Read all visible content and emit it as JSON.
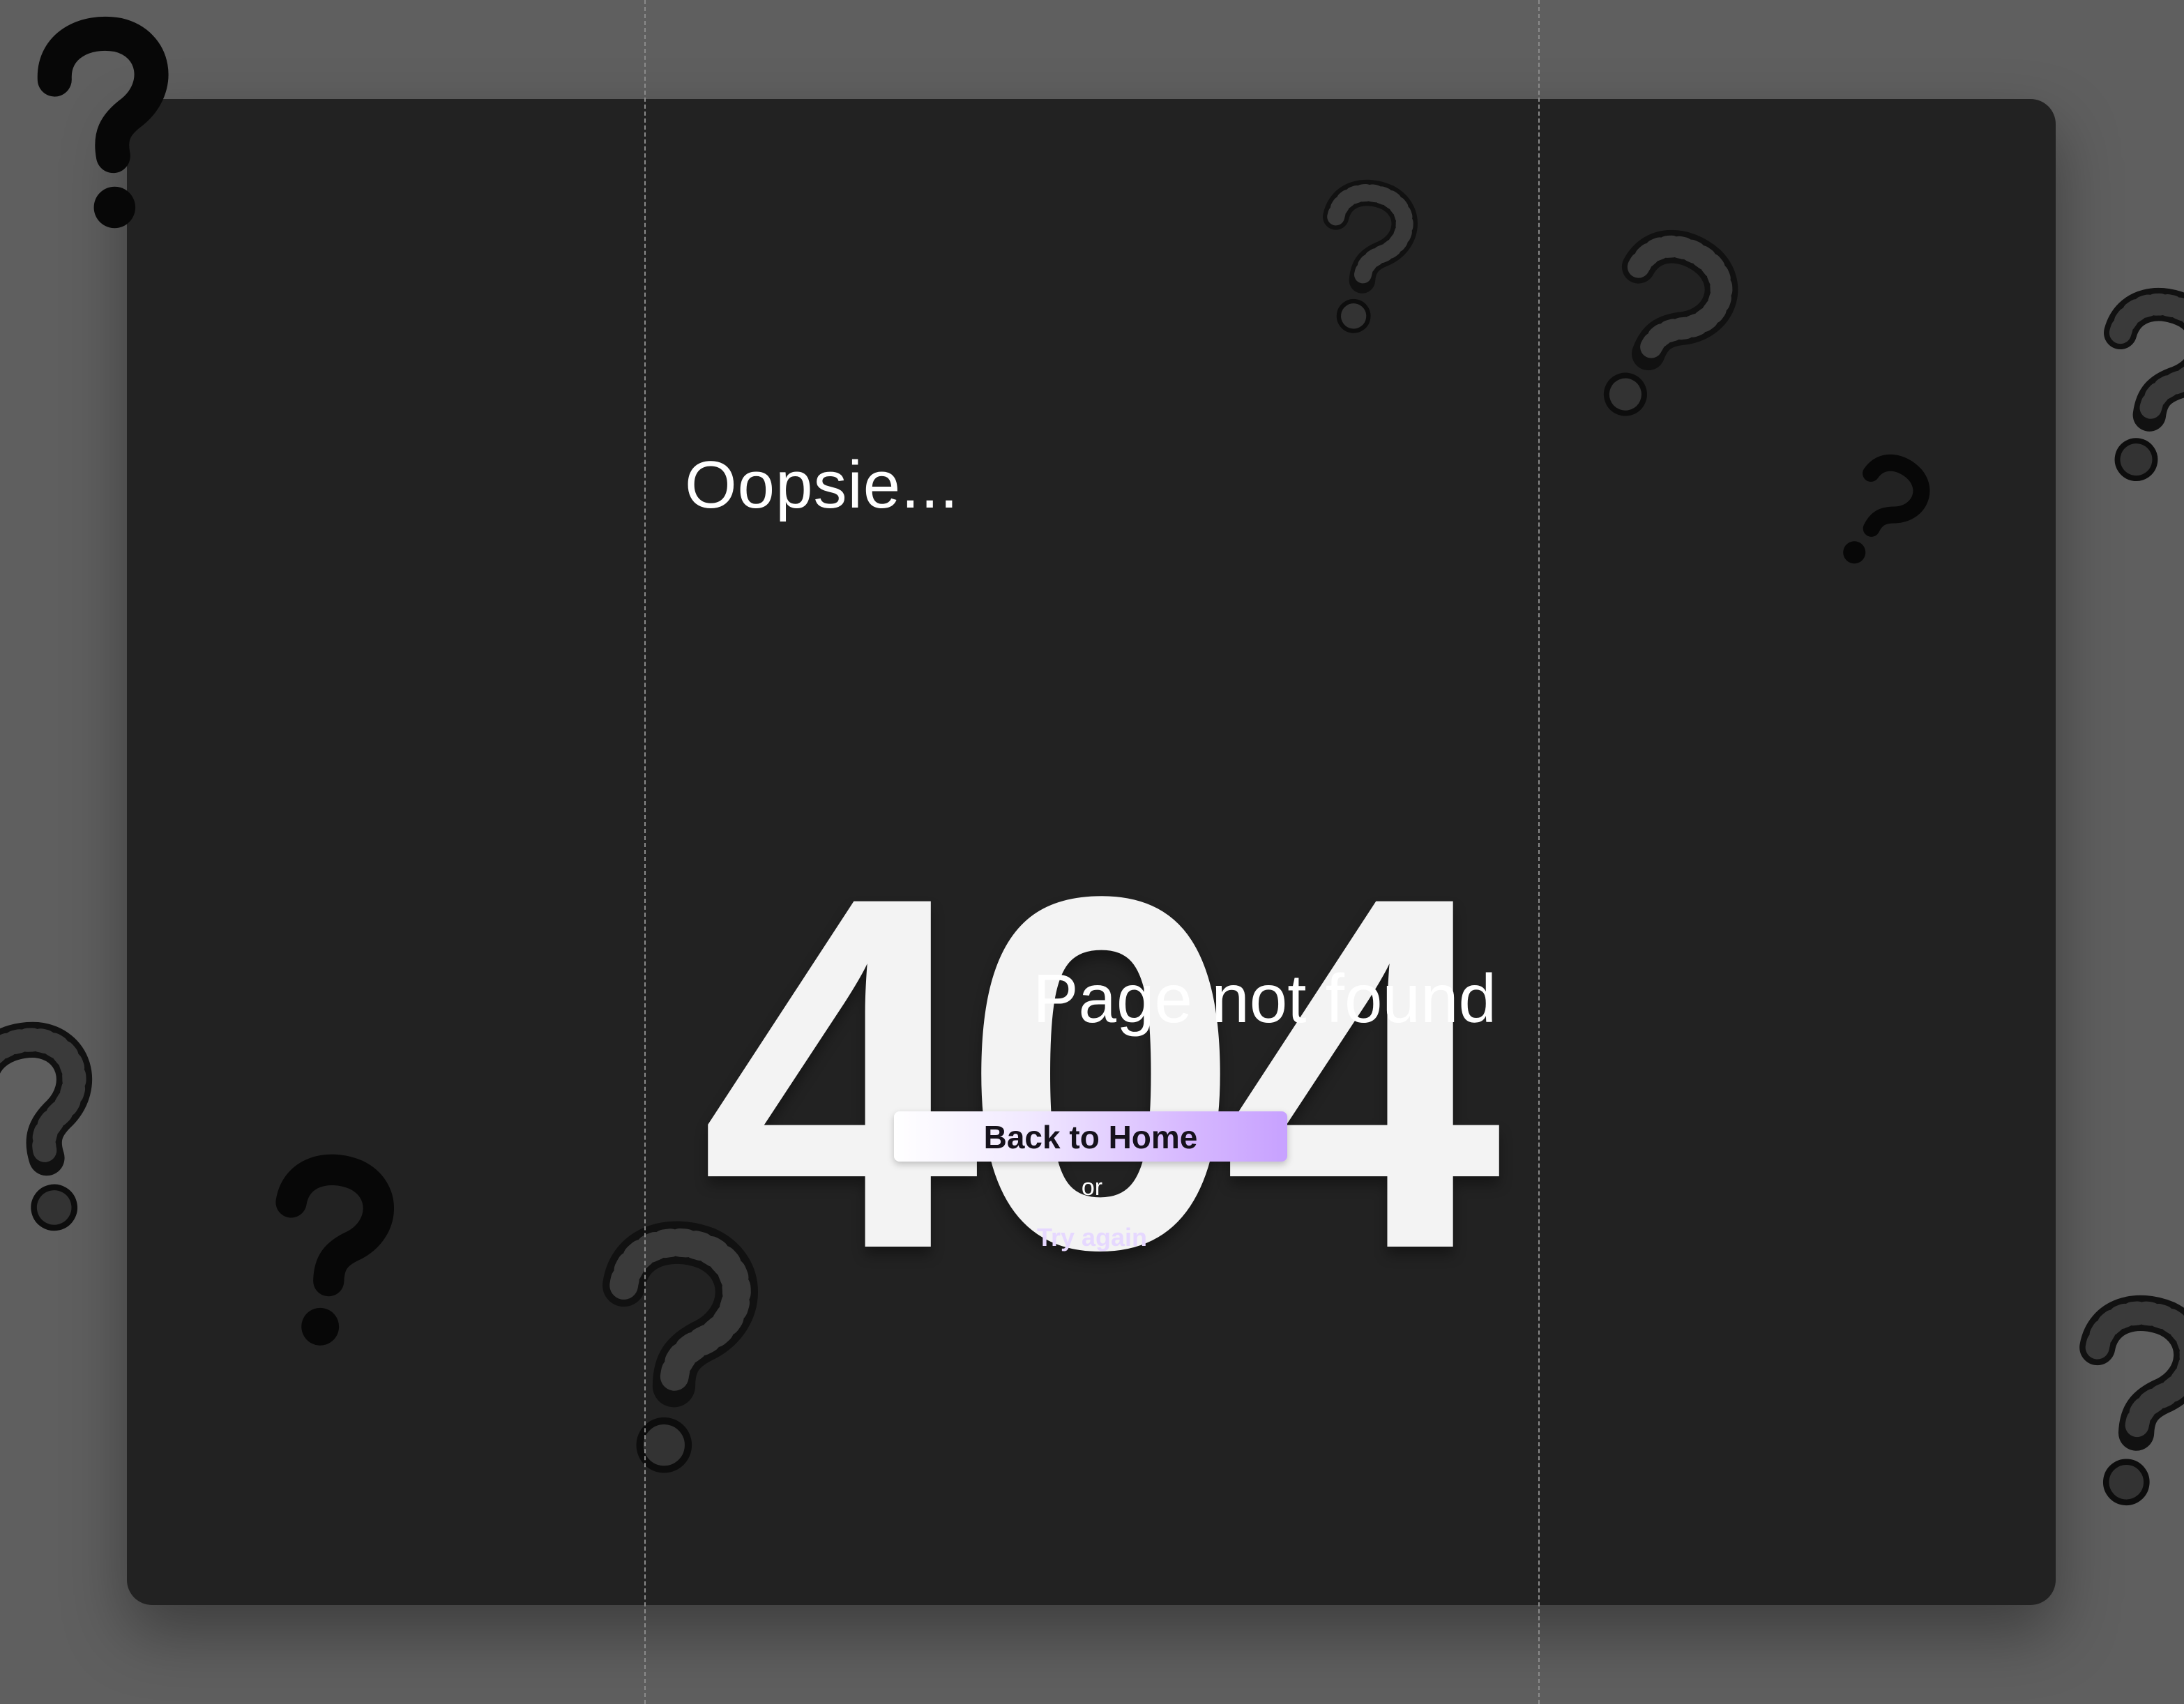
{
  "colors": {
    "page_background": "#5f5f5f",
    "panel_background": "#222222",
    "primary_text": "#ffffff",
    "error_code_text": "#f3f3f3",
    "button_gradient_start": "#ffffff",
    "button_gradient_end": "#c7a1ff",
    "link_text": "#e6d8ff"
  },
  "error_page": {
    "greeting": "Oopsie...",
    "code": "404",
    "message": "Page not found",
    "primary_action": "Back to Home",
    "separator": "or",
    "secondary_action": "Try again"
  },
  "decorations": {
    "icon": "question-mark-icon",
    "styles": [
      "solid",
      "hatched"
    ]
  }
}
